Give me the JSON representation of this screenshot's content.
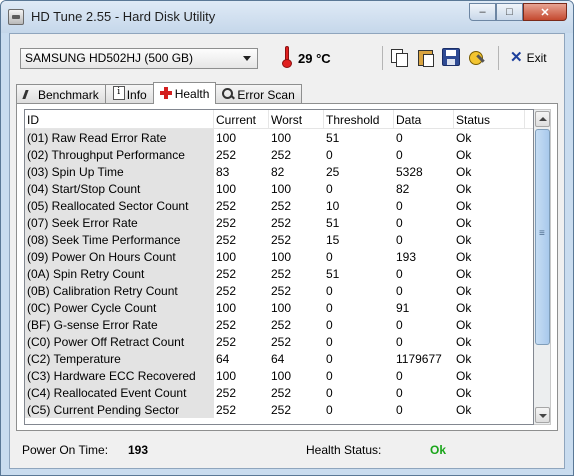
{
  "window": {
    "title": "HD Tune 2.55 - Hard Disk Utility",
    "controls": {
      "minimize": "–",
      "maximize": "□",
      "close": "✕"
    }
  },
  "toolbar": {
    "drive": "SAMSUNG HD502HJ (500 GB)",
    "temperature": "29 °C",
    "exit_label": "Exit",
    "icons": [
      "copy-text-icon",
      "copy-screenshot-icon",
      "save-icon",
      "options-icon"
    ]
  },
  "tabs": [
    {
      "label": "Benchmark",
      "icon": "benchmark-icon"
    },
    {
      "label": "Info",
      "icon": "info-icon"
    },
    {
      "label": "Health",
      "icon": "health-cross-icon",
      "active": true
    },
    {
      "label": "Error Scan",
      "icon": "magnifier-icon"
    }
  ],
  "table": {
    "columns": [
      "ID",
      "Current",
      "Worst",
      "Threshold",
      "Data",
      "Status"
    ],
    "rows": [
      [
        "(01) Raw Read Error Rate",
        "100",
        "100",
        "51",
        "0",
        "Ok"
      ],
      [
        "(02) Throughput Performance",
        "252",
        "252",
        "0",
        "0",
        "Ok"
      ],
      [
        "(03) Spin Up Time",
        "83",
        "82",
        "25",
        "5328",
        "Ok"
      ],
      [
        "(04) Start/Stop Count",
        "100",
        "100",
        "0",
        "82",
        "Ok"
      ],
      [
        "(05) Reallocated Sector Count",
        "252",
        "252",
        "10",
        "0",
        "Ok"
      ],
      [
        "(07) Seek Error Rate",
        "252",
        "252",
        "51",
        "0",
        "Ok"
      ],
      [
        "(08) Seek Time Performance",
        "252",
        "252",
        "15",
        "0",
        "Ok"
      ],
      [
        "(09) Power On Hours Count",
        "100",
        "100",
        "0",
        "193",
        "Ok"
      ],
      [
        "(0A) Spin Retry Count",
        "252",
        "252",
        "51",
        "0",
        "Ok"
      ],
      [
        "(0B) Calibration Retry Count",
        "252",
        "252",
        "0",
        "0",
        "Ok"
      ],
      [
        "(0C) Power Cycle Count",
        "100",
        "100",
        "0",
        "91",
        "Ok"
      ],
      [
        "(BF) G-sense Error Rate",
        "252",
        "252",
        "0",
        "0",
        "Ok"
      ],
      [
        "(C0) Power Off Retract Count",
        "252",
        "252",
        "0",
        "0",
        "Ok"
      ],
      [
        "(C2) Temperature",
        "64",
        "64",
        "0",
        "1179677",
        "Ok"
      ],
      [
        "(C3) Hardware ECC Recovered",
        "100",
        "100",
        "0",
        "0",
        "Ok"
      ],
      [
        "(C4) Reallocated Event Count",
        "252",
        "252",
        "0",
        "0",
        "Ok"
      ],
      [
        "(C5) Current Pending Sector",
        "252",
        "252",
        "0",
        "0",
        "Ok"
      ]
    ]
  },
  "status": {
    "power_on_label": "Power On Time:",
    "power_on_value": "193",
    "health_label": "Health Status:",
    "health_value": "Ok",
    "health_color": "#1aa51a"
  }
}
